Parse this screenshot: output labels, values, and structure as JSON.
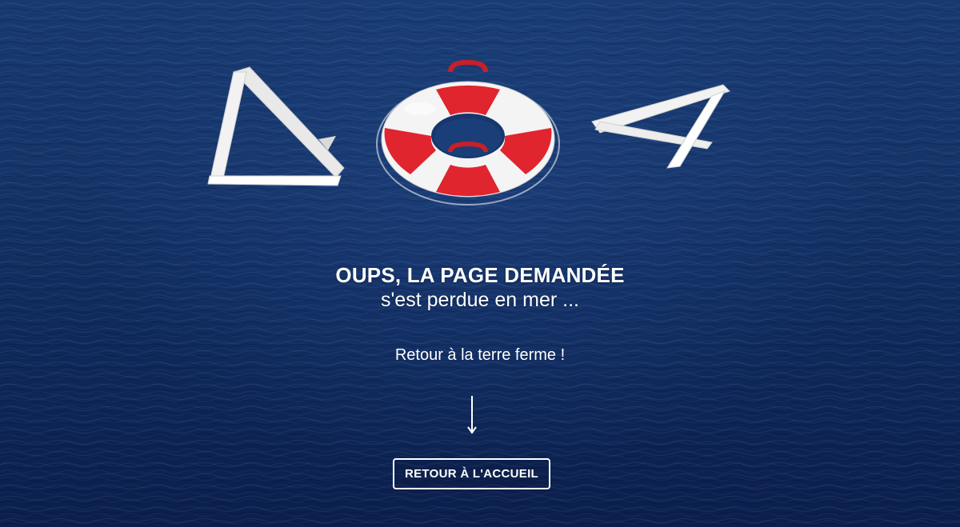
{
  "error": {
    "code_left_digit": "4",
    "code_right_digit": "4",
    "center_icon": "lifebuoy-icon"
  },
  "message": {
    "title": "OUPS, LA PAGE DEMANDÉE",
    "subtitle": "s'est perdue en mer ..."
  },
  "cta": {
    "text": "Retour à la terre ferme !",
    "arrow_icon": "arrow-down-icon",
    "button_label": "RETOUR À L'ACCUEIL"
  },
  "colors": {
    "sea_dark": "#0b1f4c",
    "sea_light": "#1a3e78",
    "lifebuoy_red": "#e0252f",
    "lifebuoy_white": "#f4f4f4",
    "text": "#ffffff"
  }
}
